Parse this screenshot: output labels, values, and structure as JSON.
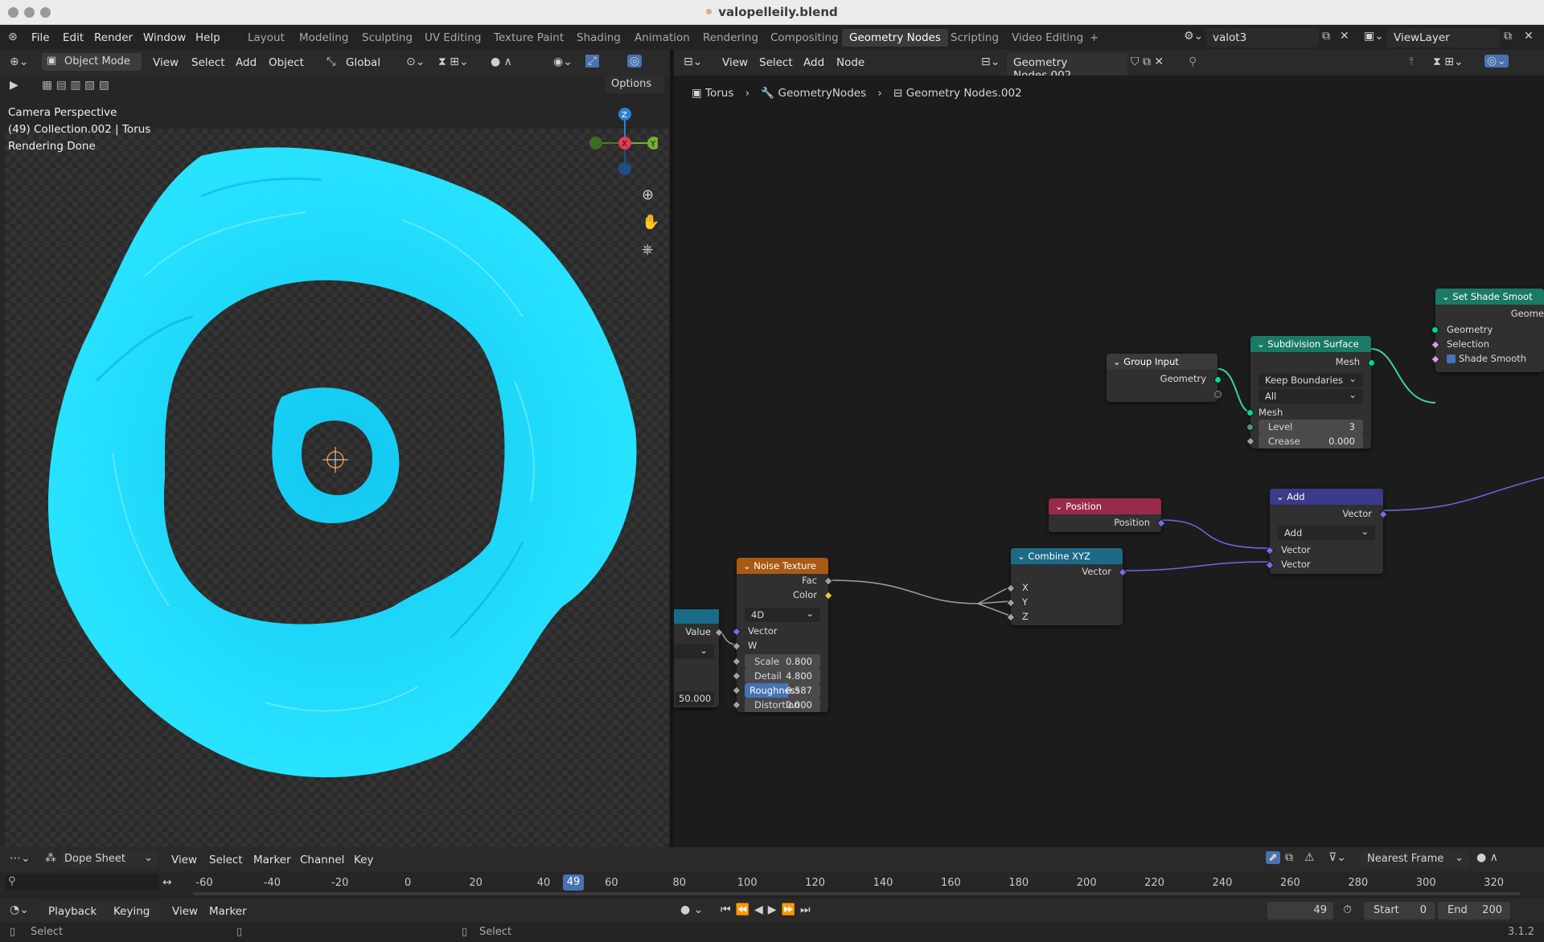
{
  "window": {
    "title": "valopelleily.blend"
  },
  "menu": [
    "File",
    "Edit",
    "Render",
    "Window",
    "Help"
  ],
  "workspaces": [
    "Layout",
    "Modeling",
    "Sculpting",
    "UV Editing",
    "Texture Paint",
    "Shading",
    "Animation",
    "Rendering",
    "Compositing",
    "Geometry Nodes",
    "Scripting",
    "Video Editing"
  ],
  "active_workspace": "Geometry Nodes",
  "scene": "valot3",
  "view_layer": "ViewLayer",
  "viewport": {
    "mode": "Object Mode",
    "menus": [
      "View",
      "Select",
      "Add",
      "Object"
    ],
    "transform": "Global",
    "options": "Options",
    "info": [
      "Camera Perspective",
      "(49) Collection.002 | Torus",
      "Rendering Done"
    ],
    "torus_color": "#1ad8ff"
  },
  "node_editor": {
    "menus": [
      "View",
      "Select",
      "Add",
      "Node"
    ],
    "tree": "Geometry Nodes.002",
    "breadcrumb": [
      "Torus",
      "GeometryNodes",
      "Geometry Nodes.002"
    ],
    "nodes": {
      "group_input": {
        "title": "Group Input",
        "out": "Geometry"
      },
      "subdiv": {
        "title": "Subdivision Surface",
        "out": "Mesh",
        "dd1": "Keep Boundaries",
        "dd2": "All",
        "in": "Mesh",
        "level_k": "Level",
        "level_v": "3",
        "crease_k": "Crease",
        "crease_v": "0.000"
      },
      "shade": {
        "title": "Set Shade Smoot",
        "out": "Geome",
        "in1": "Geometry",
        "in2": "Selection",
        "in3": "Shade Smooth"
      },
      "position": {
        "title": "Position",
        "out": "Position"
      },
      "add": {
        "title": "Add",
        "out": "Vector",
        "op": "Add",
        "in1": "Vector",
        "in2": "Vector"
      },
      "combine": {
        "title": "Combine XYZ",
        "out": "Vector",
        "x": "X",
        "y": "Y",
        "z": "Z"
      },
      "noise": {
        "title": "Noise Texture",
        "fac": "Fac",
        "color": "Color",
        "dim": "4D",
        "vec": "Vector",
        "w": "W",
        "scale_k": "Scale",
        "scale_v": "0.800",
        "detail_k": "Detail",
        "detail_v": "4.800",
        "rough_k": "Roughness",
        "rough_v": "0.587",
        "dist_k": "Distortion",
        "dist_v": "0.000"
      },
      "value": {
        "out": "Value",
        "val": "50.000"
      }
    }
  },
  "timeline": {
    "editor": "Dope Sheet",
    "menus": [
      "View",
      "Select",
      "Marker",
      "Channel",
      "Key"
    ],
    "snap": "Nearest Frame",
    "ticks": [
      "-60",
      "-40",
      "-20",
      "0",
      "20",
      "40",
      "60",
      "80",
      "100",
      "120",
      "140",
      "160",
      "180",
      "200",
      "220",
      "240",
      "260",
      "280",
      "300",
      "320"
    ],
    "current": "49",
    "play_menus": [
      "Playback",
      "Keying",
      "View",
      "Marker"
    ],
    "frame": "49",
    "start_k": "Start",
    "start_v": "0",
    "end_k": "End",
    "end_v": "200"
  },
  "status": {
    "left": "Select",
    "mid": "Select",
    "version": "3.1.2"
  }
}
